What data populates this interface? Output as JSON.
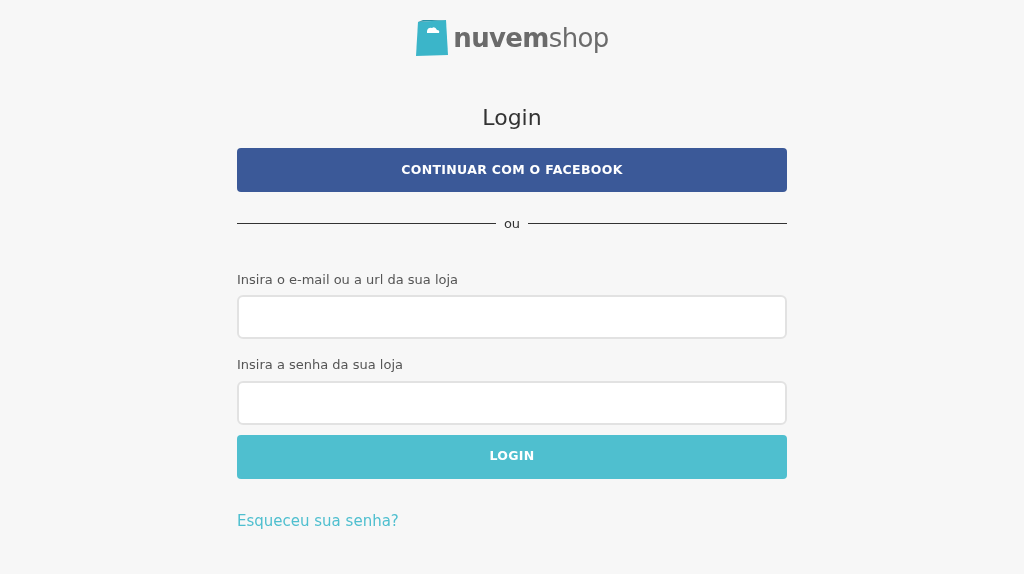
{
  "logo": {
    "text": "**nuvem**shop"
  },
  "title": "Login",
  "facebook_button": "CONTINUAR COM O FACEBOOK",
  "divider": "ou",
  "fields": [
    {
      "label": "Insira o e-mail ou a url da sua loja"
    },
    {
      "label": "Insira a senha da sua loja"
    }
  ],
  "login_button": "LOGIN",
  "forgot_link": "Esqueceu sua senha?"
}
